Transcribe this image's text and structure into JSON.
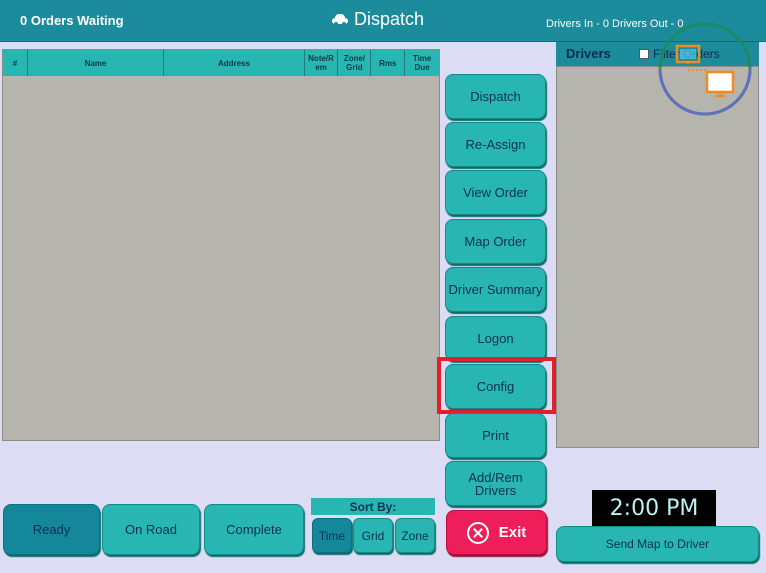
{
  "header": {
    "orders_waiting": "0 Orders Waiting",
    "title": "Dispatch",
    "drivers_status": "Drivers In - 0  Drivers Out - 0"
  },
  "table": {
    "columns": [
      "#",
      "Name",
      "Address",
      "Note/R em",
      "Zone/ Grid",
      "Rms",
      "Time Due"
    ]
  },
  "actions": {
    "dispatch": "Dispatch",
    "reassign": "Re-Assign",
    "view_order": "View Order",
    "map_order": "Map Order",
    "driver_summary": "Driver Summary",
    "logon": "Logon",
    "config": "Config",
    "print": "Print",
    "add_rem_drivers": "Add/Rem Drivers",
    "exit": "Exit"
  },
  "drivers_panel": {
    "title": "Drivers",
    "filter_label": "Filter Orders",
    "filter_checked": false
  },
  "status_tabs": {
    "ready": "Ready",
    "on_road": "On Road",
    "complete": "Complete"
  },
  "sort": {
    "label": "Sort By:",
    "time": "Time",
    "grid": "Grid",
    "zone": "Zone",
    "selected": "Time"
  },
  "clock": "2:00 PM",
  "send_map": "Send Map to Driver",
  "colors": {
    "accent": "#27b6b1",
    "header": "#1c8c9c",
    "exit": "#ee1e5a",
    "highlight": "#e0202a"
  }
}
